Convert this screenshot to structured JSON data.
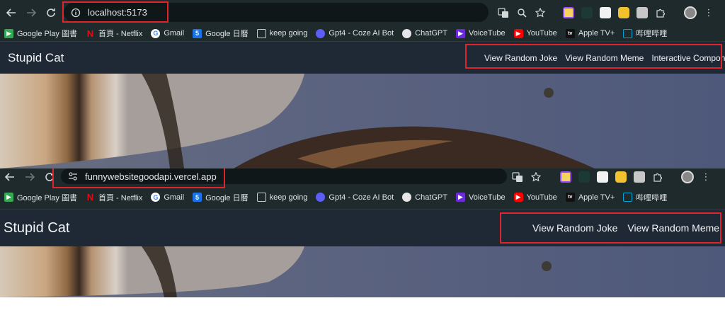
{
  "screenshot1": {
    "url": "localhost:5173",
    "bookmarks": [
      {
        "label": "Google Play 圖書",
        "icon": "google-play-icon",
        "color": "#34a853"
      },
      {
        "label": "首頁 - Netflix",
        "icon": "netflix-icon",
        "color": "#e50914"
      },
      {
        "label": "Gmail",
        "icon": "google-icon",
        "color": "#4285f4"
      },
      {
        "label": "Google 日曆",
        "icon": "google-calendar-icon",
        "color": "#1a73e8"
      },
      {
        "label": "keep going",
        "icon": "folder-icon",
        "color": "#c8cfd0"
      },
      {
        "label": "Gpt4 - Coze AI Bot",
        "icon": "coze-icon",
        "color": "#5b5ff6"
      },
      {
        "label": "ChatGPT",
        "icon": "chatgpt-icon",
        "color": "#e6e6e6"
      },
      {
        "label": "VoiceTube",
        "icon": "voicetube-icon",
        "color": "#6b2bd9"
      },
      {
        "label": "YouTube",
        "icon": "youtube-icon",
        "color": "#ff0000"
      },
      {
        "label": "Apple TV+",
        "icon": "apple-tv-icon",
        "color": "#111111"
      },
      {
        "label": "哔哩哔哩",
        "icon": "bilibili-icon",
        "color": "#00a1d6"
      }
    ],
    "app": {
      "title": "Stupid Cat",
      "links": [
        "View Random Joke",
        "View Random Meme",
        "Interactive Component"
      ]
    }
  },
  "screenshot2": {
    "url": "funnywebsitegoodapi.vercel.app",
    "bookmarks": [
      {
        "label": "Google Play 圖書",
        "icon": "google-play-icon",
        "color": "#34a853"
      },
      {
        "label": "首頁 - Netflix",
        "icon": "netflix-icon",
        "color": "#e50914"
      },
      {
        "label": "Gmail",
        "icon": "google-icon",
        "color": "#4285f4"
      },
      {
        "label": "Google 日曆",
        "icon": "google-calendar-icon",
        "color": "#1a73e8"
      },
      {
        "label": "keep going",
        "icon": "folder-icon",
        "color": "#c8cfd0"
      },
      {
        "label": "Gpt4 - Coze AI Bot",
        "icon": "coze-icon",
        "color": "#5b5ff6"
      },
      {
        "label": "ChatGPT",
        "icon": "chatgpt-icon",
        "color": "#e6e6e6"
      },
      {
        "label": "VoiceTube",
        "icon": "voicetube-icon",
        "color": "#6b2bd9"
      },
      {
        "label": "YouTube",
        "icon": "youtube-icon",
        "color": "#ff0000"
      },
      {
        "label": "Apple TV+",
        "icon": "apple-tv-icon",
        "color": "#111111"
      },
      {
        "label": "哔哩哔哩",
        "icon": "bilibili-icon",
        "color": "#00a1d6"
      }
    ],
    "app": {
      "title": "Stupid Cat",
      "links": [
        "View Random Joke",
        "View Random Meme"
      ]
    }
  },
  "colors": {
    "highlight": "#e0242b",
    "app_nav_bg": "#1f2935",
    "browser_bg": "#1f2a2c"
  }
}
